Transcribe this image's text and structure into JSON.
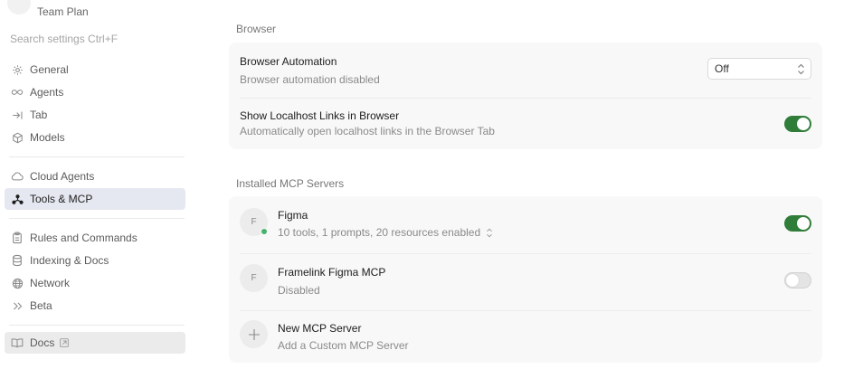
{
  "sidebar": {
    "account": {
      "avatar_letter": "L",
      "plan": "Team Plan"
    },
    "search": {
      "label": "Search settings Ctrl+F"
    },
    "groups": [
      {
        "items": [
          {
            "label": "General",
            "icon": "gear-icon"
          },
          {
            "label": "Agents",
            "icon": "infinity-icon"
          },
          {
            "label": "Tab",
            "icon": "arrow-right-bar-icon"
          },
          {
            "label": "Models",
            "icon": "cube-icon"
          }
        ]
      },
      {
        "items": [
          {
            "label": "Cloud Agents",
            "icon": "cloud-icon"
          },
          {
            "label": "Tools & MCP",
            "icon": "tools-network-icon",
            "active": true
          }
        ]
      },
      {
        "items": [
          {
            "label": "Rules and Commands",
            "icon": "clipboard-icon"
          },
          {
            "label": "Indexing & Docs",
            "icon": "database-icon"
          },
          {
            "label": "Network",
            "icon": "globe-icon"
          },
          {
            "label": "Beta",
            "icon": "double-chevron-icon"
          }
        ]
      }
    ],
    "docs": {
      "label": "Docs",
      "icon": "book-icon",
      "ext_icon": "external-link-icon"
    }
  },
  "browser": {
    "section_title": "Browser",
    "automation": {
      "title": "Browser Automation",
      "subtitle": "Browser automation disabled",
      "select_value": "Off"
    },
    "localhost": {
      "title": "Show Localhost Links in Browser",
      "subtitle": "Automatically open localhost links in the Browser Tab",
      "enabled": true
    }
  },
  "mcp": {
    "section_title": "Installed MCP Servers",
    "servers": [
      {
        "avatar": "F",
        "name": "Figma",
        "status": "10 tools, 1 prompts, 20 resources enabled",
        "enabled": true,
        "connected": true
      },
      {
        "avatar": "F",
        "name": "Framelink Figma MCP",
        "status": "Disabled",
        "enabled": false
      }
    ],
    "new_server": {
      "title": "New MCP Server",
      "subtitle": "Add a Custom MCP Server"
    }
  },
  "colors": {
    "toggle_on": "#2f7d39",
    "active_nav": "#e5e8f0",
    "status_dot": "#45b36b"
  }
}
